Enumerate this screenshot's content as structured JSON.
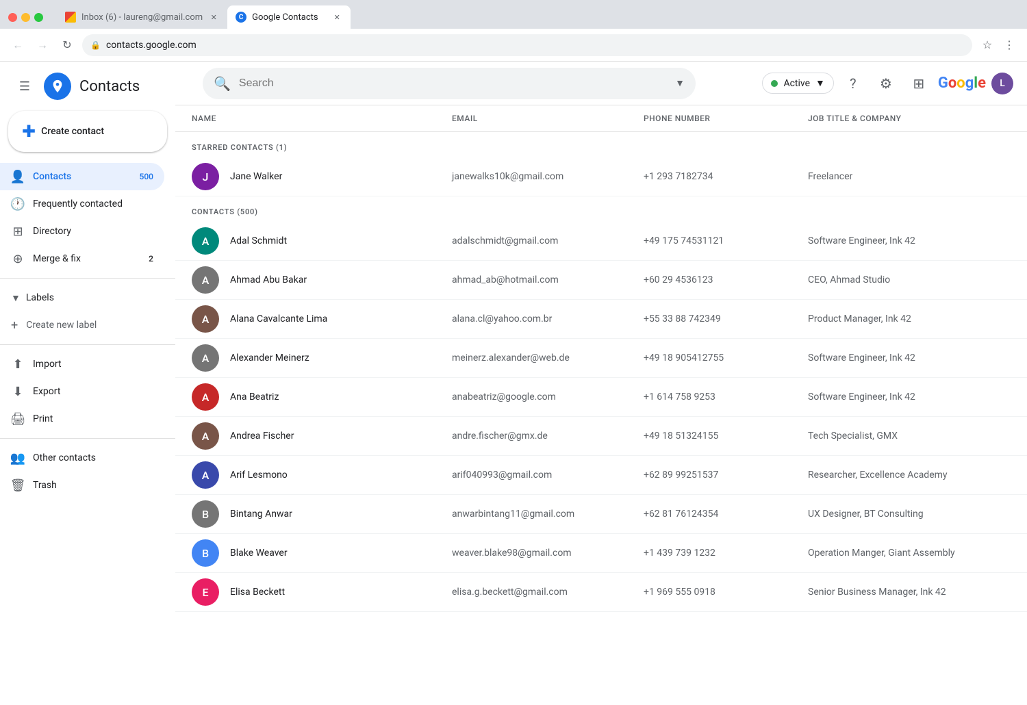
{
  "browser": {
    "tabs": [
      {
        "id": "gmail",
        "label": "Inbox (6) - laureng@gmail.com",
        "active": false,
        "favicon": "gmail"
      },
      {
        "id": "contacts",
        "label": "Google Contacts",
        "active": true,
        "favicon": "contacts"
      }
    ],
    "address": "contacts.google.com"
  },
  "header": {
    "app_title": "Contacts",
    "search_placeholder": "Search",
    "status_label": "Active",
    "help_icon": "?",
    "google_logo": "Google"
  },
  "sidebar": {
    "create_button": "Create contact",
    "nav_items": [
      {
        "id": "contacts",
        "label": "Contacts",
        "icon": "person",
        "badge": "500",
        "active": true
      },
      {
        "id": "frequently",
        "label": "Frequently contacted",
        "icon": "history",
        "badge": "",
        "active": false
      },
      {
        "id": "directory",
        "label": "Directory",
        "icon": "grid",
        "badge": "",
        "active": false
      },
      {
        "id": "merge",
        "label": "Merge & fix",
        "icon": "merge",
        "badge": "2",
        "active": false
      }
    ],
    "labels_section": "Labels",
    "create_label": "Create new label",
    "bottom_items": [
      {
        "id": "import",
        "label": "Import",
        "icon": "upload"
      },
      {
        "id": "export",
        "label": "Export",
        "icon": "download"
      },
      {
        "id": "print",
        "label": "Print",
        "icon": "print"
      }
    ],
    "other_contacts": "Other contacts",
    "trash": "Trash"
  },
  "table": {
    "headers": [
      "Name",
      "Email",
      "Phone number",
      "Job title & company"
    ],
    "starred_section": "STARRED CONTACTS (1)",
    "contacts_section": "CONTACTS (500)",
    "starred": [
      {
        "name": "Jane Walker",
        "email": "janewalks10k@gmail.com",
        "phone": "+1 293 7182734",
        "job": "Freelancer",
        "avatar_color": "av-purple",
        "initials": "J"
      }
    ],
    "contacts": [
      {
        "name": "Adal Schmidt",
        "email": "adalschmidt@gmail.com",
        "phone": "+49 175 74531121",
        "job": "Software Engineer, Ink 42",
        "avatar_color": "av-teal",
        "initials": "A"
      },
      {
        "name": "Ahmad Abu Bakar",
        "email": "ahmad_ab@hotmail.com",
        "phone": "+60 29 4536123",
        "job": "CEO, Ahmad Studio",
        "avatar_color": "av-gray",
        "initials": "A"
      },
      {
        "name": "Alana Cavalcante Lima",
        "email": "alana.cl@yahoo.com.br",
        "phone": "+55 33 88 742349",
        "job": "Product Manager, Ink 42",
        "avatar_color": "av-brown",
        "initials": "A"
      },
      {
        "name": "Alexander Meinerz",
        "email": "meinerz.alexander@web.de",
        "phone": "+49 18 905412755",
        "job": "Software Engineer, Ink 42",
        "avatar_color": "av-gray",
        "initials": "A"
      },
      {
        "name": "Ana Beatriz",
        "email": "anabeatriz@google.com",
        "phone": "+1 614 758 9253",
        "job": "Software Engineer, Ink 42",
        "avatar_color": "av-red",
        "initials": "A"
      },
      {
        "name": "Andrea Fischer",
        "email": "andre.fischer@gmx.de",
        "phone": "+49 18 51324155",
        "job": "Tech Specialist, GMX",
        "avatar_color": "av-brown",
        "initials": "A"
      },
      {
        "name": "Arif Lesmono",
        "email": "arif040993@gmail.com",
        "phone": "+62 89 99251537",
        "job": "Researcher, Excellence Academy",
        "avatar_color": "av-indigo",
        "initials": "A"
      },
      {
        "name": "Bintang Anwar",
        "email": "anwarbintang11@gmail.com",
        "phone": "+62 81 76124354",
        "job": "UX Designer, BT Consulting",
        "avatar_color": "av-gray",
        "initials": "B"
      },
      {
        "name": "Blake Weaver",
        "email": "weaver.blake98@gmail.com",
        "phone": "+1 439 739 1232",
        "job": "Operation Manger, Giant Assembly",
        "avatar_color": "av-blue",
        "initials": "B"
      },
      {
        "name": "Elisa Beckett",
        "email": "elisa.g.beckett@gmail.com",
        "phone": "+1 969 555 0918",
        "job": "Senior Business Manager, Ink 42",
        "avatar_color": "av-pink",
        "initials": "E"
      }
    ]
  }
}
